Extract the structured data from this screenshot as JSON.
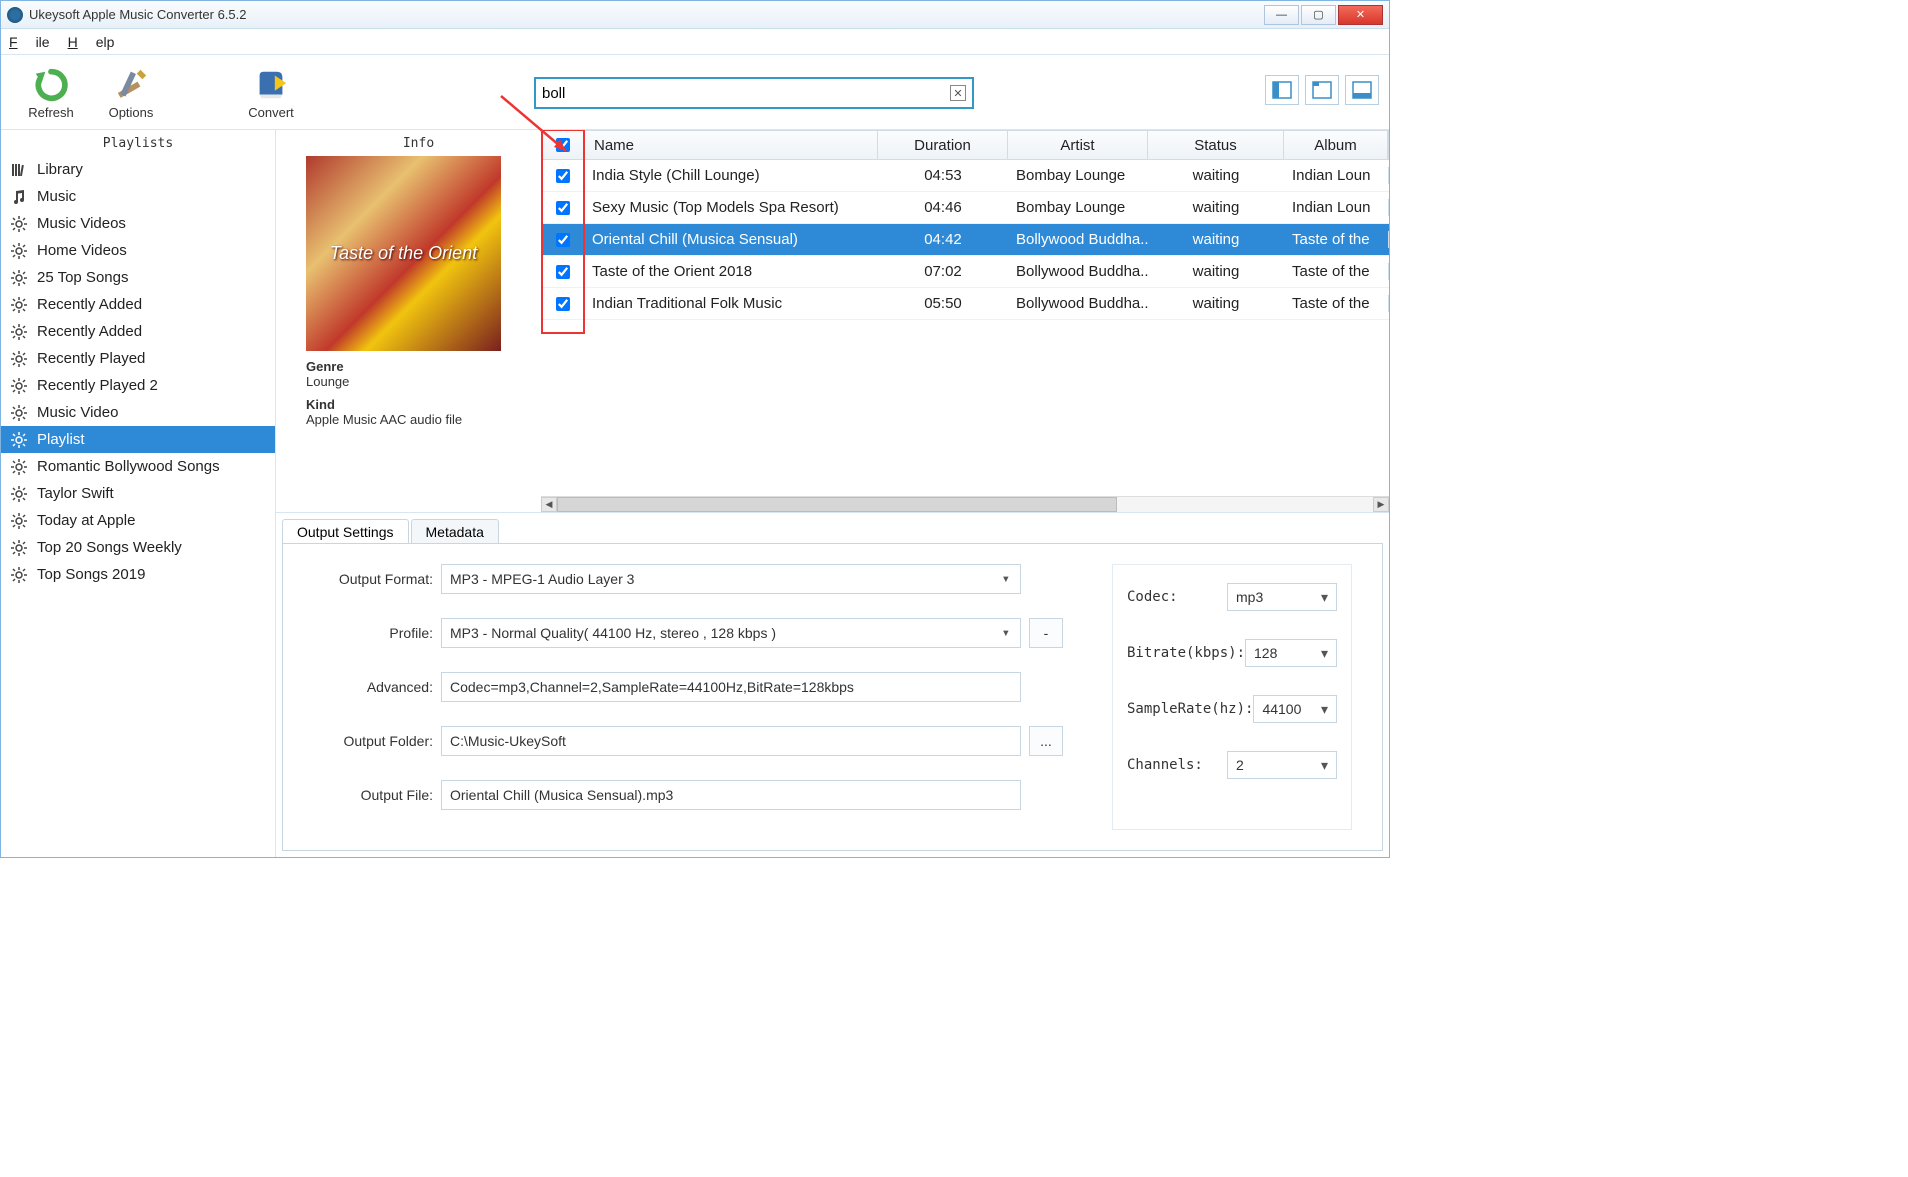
{
  "window": {
    "title": "Ukeysoft Apple Music Converter 6.5.2"
  },
  "menu": {
    "file": "File",
    "help": "Help"
  },
  "toolbar": {
    "refresh": "Refresh",
    "options": "Options",
    "convert": "Convert",
    "search_value": "boll"
  },
  "sidebar": {
    "header": "Playlists",
    "items": [
      {
        "label": "Library",
        "icon": "library",
        "selected": false
      },
      {
        "label": "Music",
        "icon": "music",
        "selected": false
      },
      {
        "label": "Music Videos",
        "icon": "gear",
        "selected": false
      },
      {
        "label": "Home Videos",
        "icon": "gear",
        "selected": false
      },
      {
        "label": "25 Top Songs",
        "icon": "gear",
        "selected": false
      },
      {
        "label": "Recently Added",
        "icon": "gear",
        "selected": false
      },
      {
        "label": "Recently Added",
        "icon": "gear",
        "selected": false
      },
      {
        "label": "Recently Played",
        "icon": "gear",
        "selected": false
      },
      {
        "label": "Recently Played 2",
        "icon": "gear",
        "selected": false
      },
      {
        "label": "Music Video",
        "icon": "gear",
        "selected": false
      },
      {
        "label": "Playlist",
        "icon": "gear",
        "selected": true
      },
      {
        "label": "Romantic Bollywood Songs",
        "icon": "gear",
        "selected": false
      },
      {
        "label": "Taylor Swift",
        "icon": "gear",
        "selected": false
      },
      {
        "label": "Today at Apple",
        "icon": "gear",
        "selected": false
      },
      {
        "label": "Top 20 Songs Weekly",
        "icon": "gear",
        "selected": false
      },
      {
        "label": "Top Songs 2019",
        "icon": "gear",
        "selected": false
      }
    ]
  },
  "info": {
    "header": "Info",
    "album_title_line": "Taste of the Orient",
    "genre_label": "Genre",
    "genre_value": "Lounge",
    "kind_label": "Kind",
    "kind_value": "Apple Music AAC audio file"
  },
  "tracks": {
    "columns": {
      "name": "Name",
      "duration": "Duration",
      "artist": "Artist",
      "status": "Status",
      "album": "Album"
    },
    "selected_index": 2,
    "rows": [
      {
        "checked": true,
        "name": "India Style (Chill Lounge)",
        "duration": "04:53",
        "artist": "Bombay Lounge",
        "status": "waiting",
        "album": "Indian Loun"
      },
      {
        "checked": true,
        "name": "Sexy Music (Top Models Spa Resort)",
        "duration": "04:46",
        "artist": "Bombay Lounge",
        "status": "waiting",
        "album": "Indian Loun"
      },
      {
        "checked": true,
        "name": "Oriental Chill (Musica Sensual)",
        "duration": "04:42",
        "artist": "Bollywood Buddha...",
        "status": "waiting",
        "album": "Taste of the"
      },
      {
        "checked": true,
        "name": "Taste of the Orient 2018",
        "duration": "07:02",
        "artist": "Bollywood Buddha...",
        "status": "waiting",
        "album": "Taste of the"
      },
      {
        "checked": true,
        "name": "Indian Traditional Folk Music",
        "duration": "05:50",
        "artist": "Bollywood Buddha...",
        "status": "waiting",
        "album": "Taste of the"
      }
    ]
  },
  "tabs": {
    "output": "Output Settings",
    "metadata": "Metadata"
  },
  "settings": {
    "output_format_label": "Output Format:",
    "output_format_value": "MP3 - MPEG-1 Audio Layer 3",
    "profile_label": "Profile:",
    "profile_value": "MP3 - Normal Quality( 44100 Hz, stereo , 128 kbps )",
    "profile_btn": "-",
    "advanced_label": "Advanced:",
    "advanced_value": "Codec=mp3,Channel=2,SampleRate=44100Hz,BitRate=128kbps",
    "folder_label": "Output Folder:",
    "folder_value": "C:\\Music-UkeySoft",
    "folder_btn": "...",
    "file_label": "Output File:",
    "file_value": "Oriental Chill (Musica Sensual).mp3",
    "codec_label": "Codec:",
    "codec_value": "mp3",
    "bitrate_label": "Bitrate(kbps):",
    "bitrate_value": "128",
    "samplerate_label": "SampleRate(hz):",
    "samplerate_value": "44100",
    "channels_label": "Channels:",
    "channels_value": "2"
  }
}
